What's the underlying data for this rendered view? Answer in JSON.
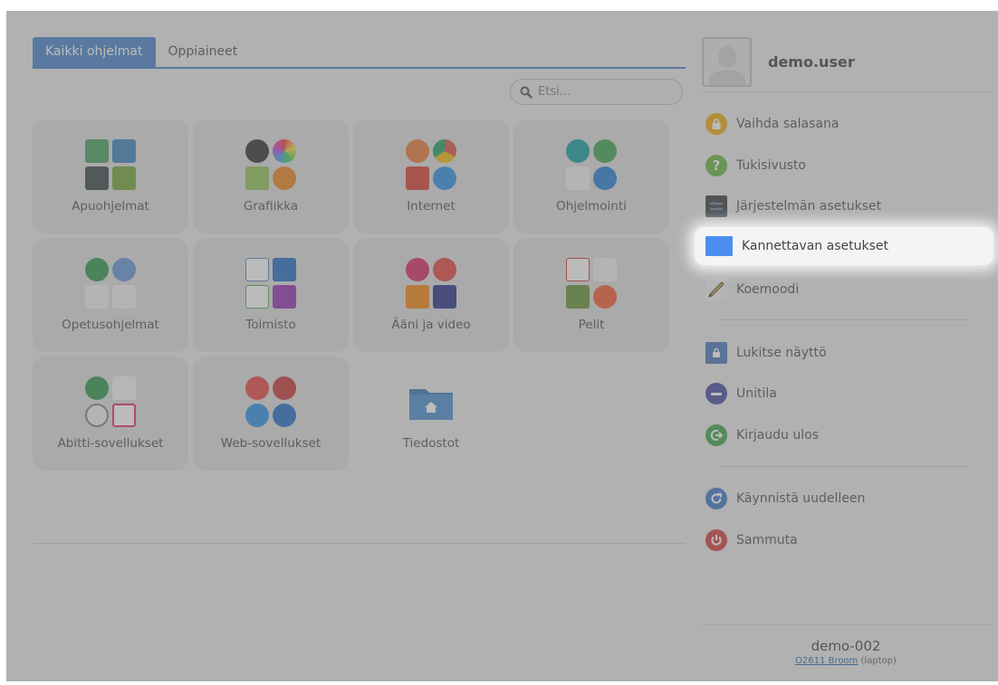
{
  "tabs": [
    {
      "label": "Kaikki ohjelmat",
      "active": true
    },
    {
      "label": "Oppiaineet",
      "active": false
    }
  ],
  "search": {
    "placeholder": "Etsi..."
  },
  "categories": [
    {
      "label": "Apuohjelmat"
    },
    {
      "label": "Grafiikka"
    },
    {
      "label": "Internet"
    },
    {
      "label": "Ohjelmointi"
    },
    {
      "label": "Opetusohjelmat"
    },
    {
      "label": "Toimisto"
    },
    {
      "label": "Ääni ja video"
    },
    {
      "label": "Pelit"
    },
    {
      "label": "Abitti-sovellukset"
    },
    {
      "label": "Web-sovellukset"
    },
    {
      "label": "Tiedostot"
    }
  ],
  "user": {
    "name": "demo.user"
  },
  "actions": [
    {
      "label": "Vaihda salasana",
      "icon": "lock-icon"
    },
    {
      "label": "Tukisivusto",
      "icon": "help-icon"
    },
    {
      "label": "Järjestelmän asetukset",
      "icon": "settings-sliders-icon"
    },
    {
      "label": "Kannettavan asetukset",
      "icon": "laptop-settings-icon"
    },
    {
      "label": "Koemoodi",
      "icon": "pencil-icon"
    },
    {
      "label": "Lukitse näyttö",
      "icon": "lock-screen-icon"
    },
    {
      "label": "Unitila",
      "icon": "sleep-icon"
    },
    {
      "label": "Kirjaudu ulos",
      "icon": "logout-icon"
    },
    {
      "label": "Käynnistä uudelleen",
      "icon": "restart-icon"
    },
    {
      "label": "Sammuta",
      "icon": "power-icon"
    }
  ],
  "footer": {
    "host": "demo-002",
    "location_link": "O2611 Broom",
    "location_suffix": " (laptop)"
  },
  "colors": {
    "accent": "#3b7bc8",
    "highlight": "#f4f4f4"
  }
}
